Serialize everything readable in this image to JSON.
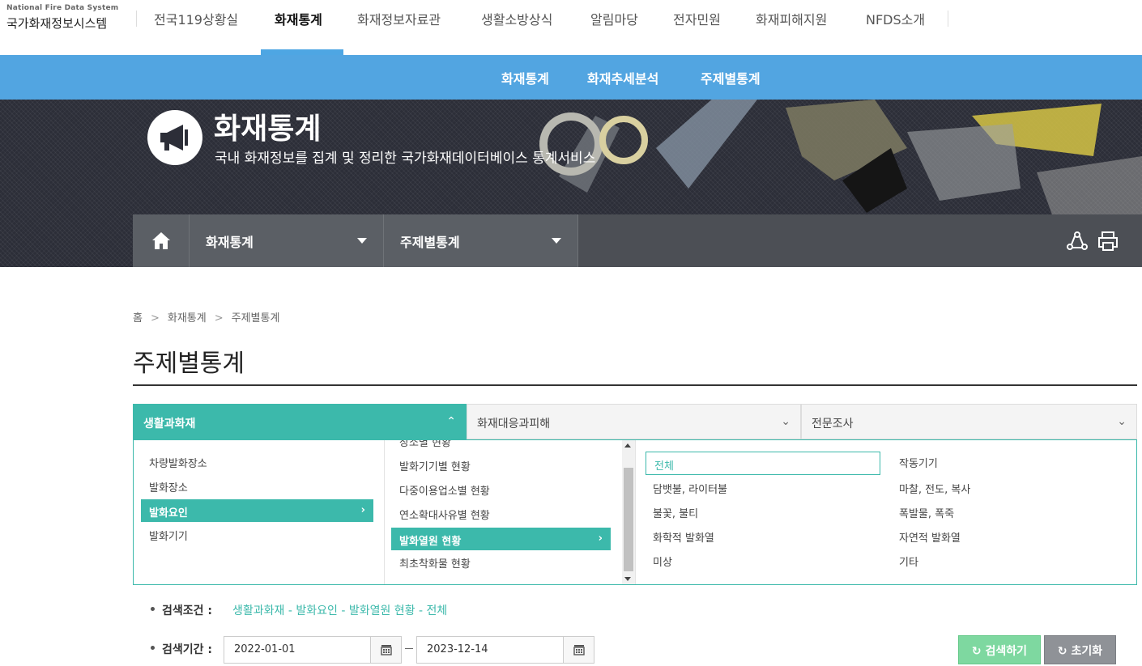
{
  "logo": {
    "en": "National Fire Data System",
    "ko": "국가화재정보시스템"
  },
  "gnb": [
    {
      "label": "전국119상황실"
    },
    {
      "label": "화재통계"
    },
    {
      "label": "화재정보자료관"
    },
    {
      "label": "생활소방상식"
    },
    {
      "label": "알림마당"
    },
    {
      "label": "전자민원"
    },
    {
      "label": "화재피해지원"
    },
    {
      "label": "NFDS소개"
    }
  ],
  "subnav": [
    {
      "label": "화재통계"
    },
    {
      "label": "화재추세분석"
    },
    {
      "label": "주제별통계"
    }
  ],
  "hero": {
    "title": "화재통계",
    "subtitle": "국내 화재정보를 집계 및 정리한 국가화재데이터베이스 통계서비스"
  },
  "location": {
    "home_icon": "home-icon",
    "level1": "화재통계",
    "level2": "주제별통계",
    "tools": [
      "share-icon",
      "print-icon"
    ]
  },
  "breadcrumb": [
    "홈",
    "화재통계",
    "주제별통계"
  ],
  "page_title": "주제별통계",
  "tabs": [
    {
      "label": "생활과화재",
      "expanded": true
    },
    {
      "label": "화재대응과피해"
    },
    {
      "label": "전문조사"
    }
  ],
  "col1": [
    "차량발화장소",
    "발화장소",
    "발화요인",
    "발화기기"
  ],
  "col2": [
    "장소별 현황",
    "발화기기별 현황",
    "다중이용업소별 현황",
    "연소확대사유별 현황",
    "발화열원 현황",
    "최초착화물 현황"
  ],
  "col3_left": [
    "전체",
    "담뱃불, 라이터불",
    "불꽃, 불티",
    "화학적 발화열",
    "미상"
  ],
  "col3_right": [
    "작동기기",
    "마찰, 전도, 복사",
    "폭발물, 폭죽",
    "자연적 발화열",
    "기타"
  ],
  "search": {
    "condition_label": "검색조건 :",
    "condition_value": "생활과화재 - 발화요인 - 발화열원 현황 - 전체",
    "period_label": "검색기간 :",
    "date_from": "2022-01-01",
    "date_to": "2023-12-14",
    "calendar_icon": "calendar-icon",
    "search_button": "검색하기",
    "reset_button": "초기화"
  },
  "colors": {
    "accent": "#3cb9ab",
    "nav_blue": "#52a5e1",
    "search_btn": "#7ed8a0",
    "reset_btn": "#8f9297"
  }
}
